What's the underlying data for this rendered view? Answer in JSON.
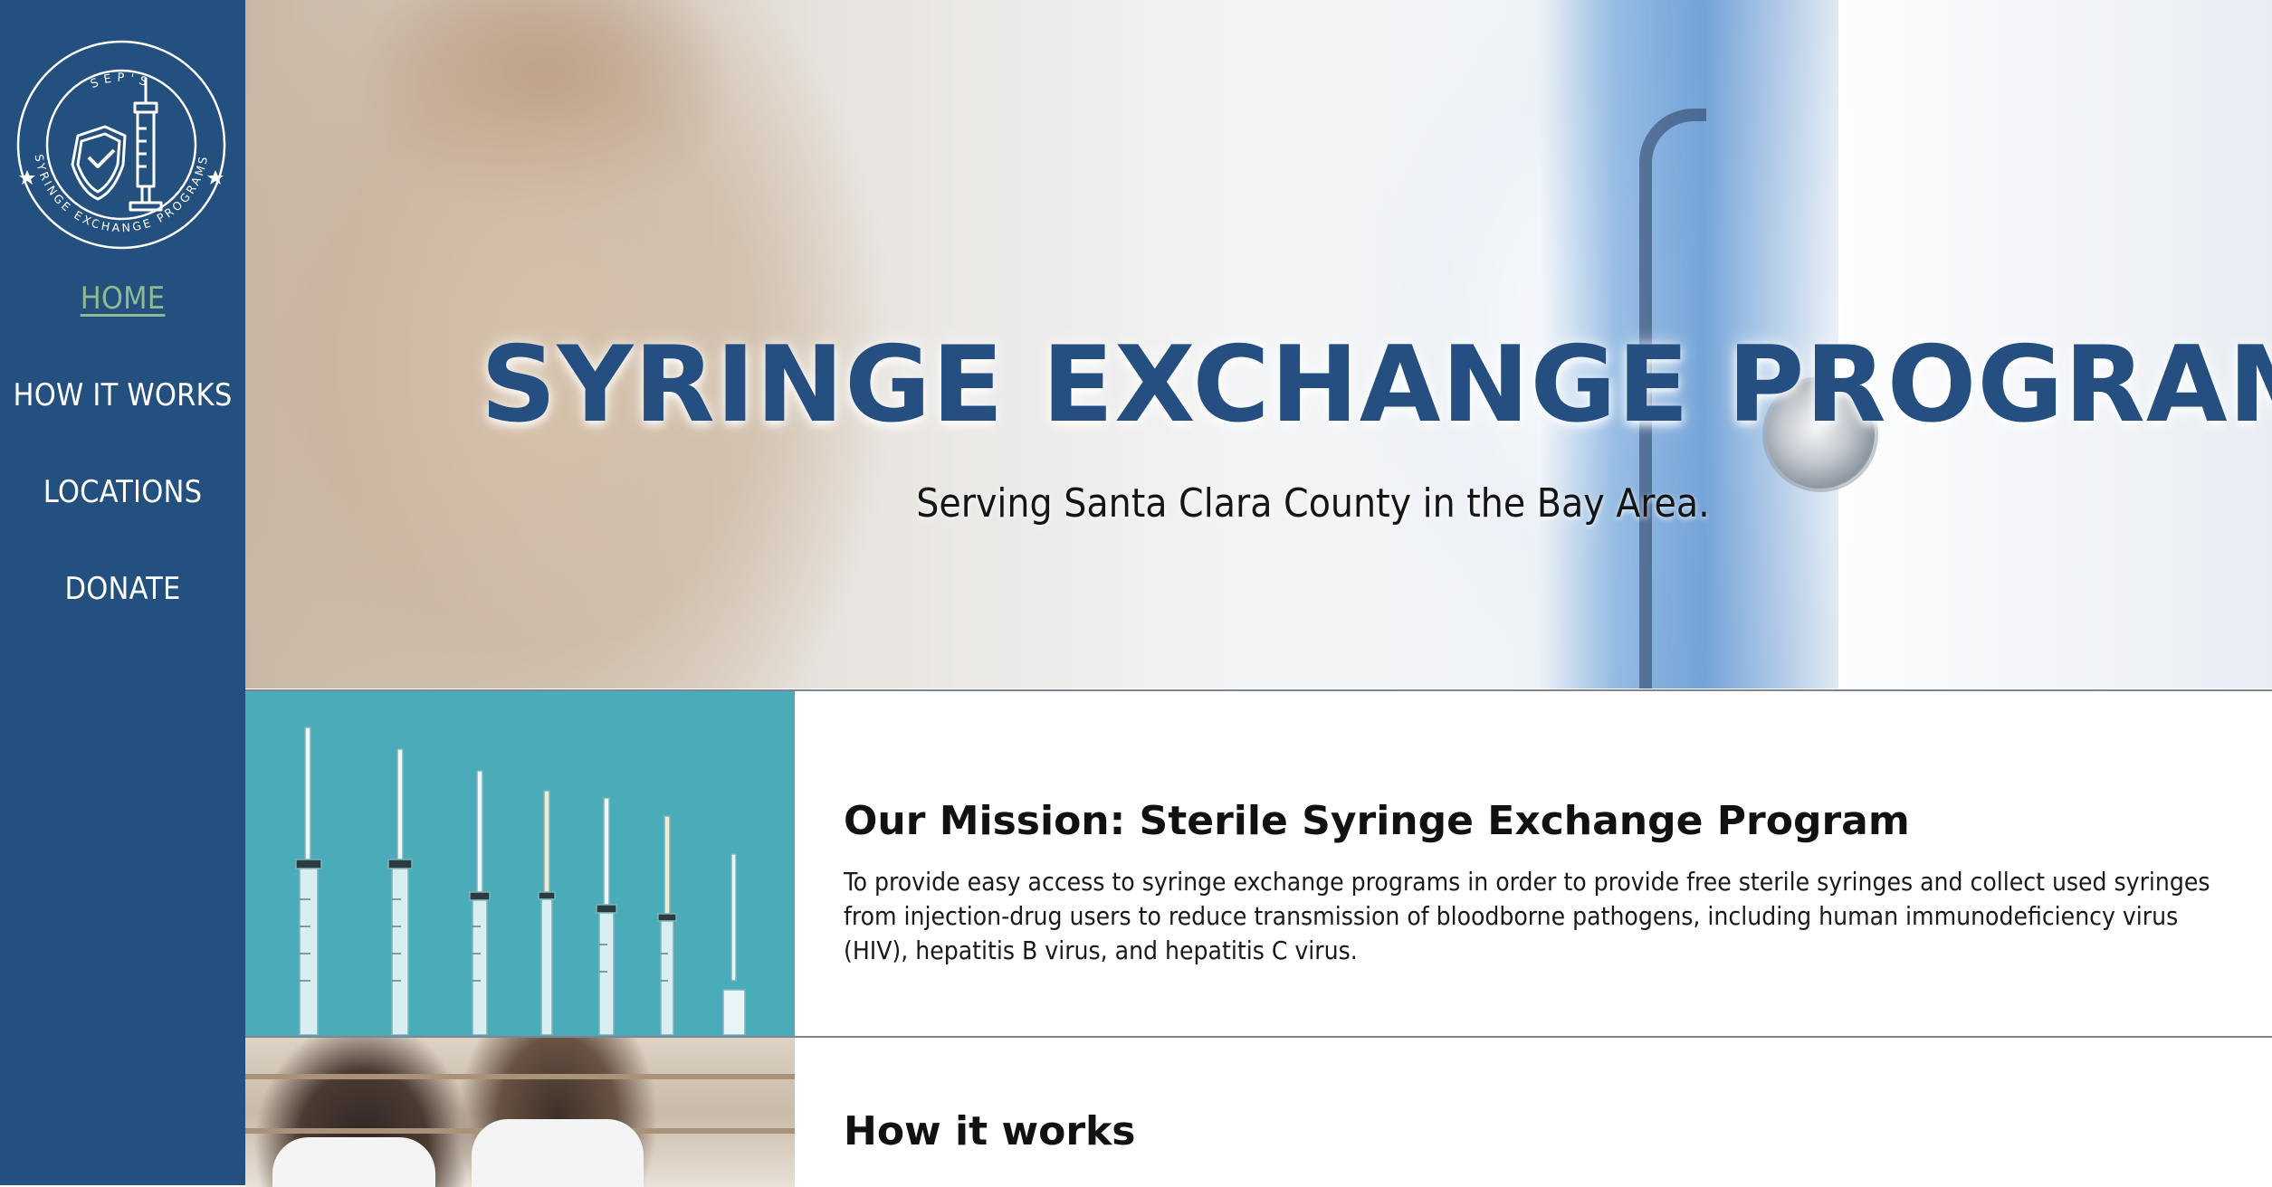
{
  "brand": {
    "logo_top_text": "SEP'S",
    "logo_ring_text": "SYRINGE EXCHANGE PROGRAMS"
  },
  "sidebar": {
    "items": [
      {
        "label": "HOME",
        "active": true
      },
      {
        "label": "HOW IT WORKS",
        "active": false
      },
      {
        "label": "LOCATIONS",
        "active": false
      },
      {
        "label": "DONATE",
        "active": false
      }
    ]
  },
  "hero": {
    "title": "SYRINGE EXCHANGE PROGRAM",
    "subtitle": "Serving Santa Clara County in the Bay Area."
  },
  "sections": [
    {
      "heading": "Our Mission: Sterile Syringe Exchange Program",
      "body": "To provide easy access to syringe exchange programs in order to provide free sterile syringes and collect used syringes from injection-drug users to reduce transmission of bloodborne pathogens, including human immunodeficiency virus (HIV), hepatitis B virus, and hepatitis C virus."
    },
    {
      "heading": "How it works",
      "body": ""
    }
  ],
  "colors": {
    "sidebar": "#23507f",
    "nav_active": "#8fb98f",
    "title": "#244f80",
    "divider": "#7d8592",
    "syringe_bg": "#4aabb9"
  },
  "icons": [
    "shield-check-icon",
    "syringe-icon",
    "star-icon"
  ]
}
